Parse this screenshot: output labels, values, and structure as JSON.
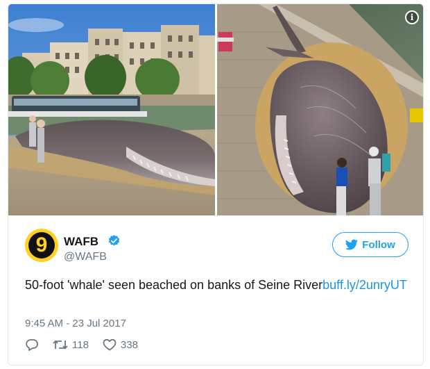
{
  "author": {
    "name": "WAFB",
    "handle": "@WAFB",
    "avatar_glyph": "9",
    "verified": true
  },
  "follow": {
    "label": "Follow"
  },
  "tweet": {
    "text": "50-foot 'whale' seen beached on banks of Seine River",
    "link": "buff.ly/2unryUT",
    "timestamp": "9:45 AM - 23 Jul 2017"
  },
  "stats": {
    "retweets": "118",
    "likes": "338"
  },
  "media": {
    "info_glyph": "i"
  },
  "icons": {
    "reply": "reply-icon",
    "retweet": "retweet-icon",
    "like": "heart-icon",
    "follow": "twitter-bird-icon",
    "verified": "verified-badge-icon",
    "info": "info-icon"
  },
  "colors": {
    "twitter_blue": "#1da1f2",
    "link_blue": "#1b95e0",
    "muted": "#657786",
    "avatar_yellow": "#ffd21f"
  }
}
